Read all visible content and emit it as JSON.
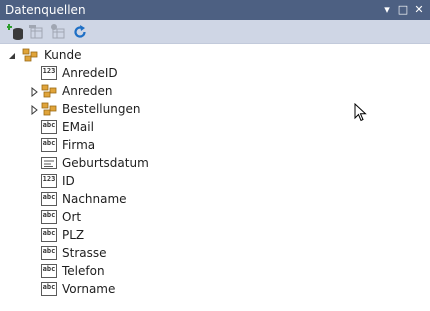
{
  "panel": {
    "title": "Datenquellen",
    "buttons": {
      "dropdown": "▾",
      "maximize": "□",
      "close": "✕"
    }
  },
  "toolbar": {
    "items": [
      {
        "name": "add-datasource-icon",
        "enabled": true
      },
      {
        "name": "edit-dataset-icon",
        "enabled": false
      },
      {
        "name": "configure-dataset-icon",
        "enabled": false
      },
      {
        "name": "refresh-icon",
        "enabled": true
      }
    ]
  },
  "tree": {
    "root": {
      "label": "Kunde",
      "icon": "object-icon",
      "expanded": true
    },
    "children": [
      {
        "label": "AnredeID",
        "icon": "numeric-field-icon",
        "icontext": "123"
      },
      {
        "label": "Anreden",
        "icon": "object-icon",
        "expandable": true
      },
      {
        "label": "Bestellungen",
        "icon": "object-icon",
        "expandable": true
      },
      {
        "label": "EMail",
        "icon": "text-field-icon",
        "icontext": "abc"
      },
      {
        "label": "Firma",
        "icon": "text-field-icon",
        "icontext": "abc"
      },
      {
        "label": "Geburtsdatum",
        "icon": "date-field-icon",
        "icontext": ""
      },
      {
        "label": "ID",
        "icon": "numeric-field-icon",
        "icontext": "123"
      },
      {
        "label": "Nachname",
        "icon": "text-field-icon",
        "icontext": "abc"
      },
      {
        "label": "Ort",
        "icon": "text-field-icon",
        "icontext": "abc"
      },
      {
        "label": "PLZ",
        "icon": "text-field-icon",
        "icontext": "abc"
      },
      {
        "label": "Strasse",
        "icon": "text-field-icon",
        "icontext": "abc"
      },
      {
        "label": "Telefon",
        "icon": "text-field-icon",
        "icontext": "abc"
      },
      {
        "label": "Vorname",
        "icon": "text-field-icon",
        "icontext": "abc"
      }
    ]
  },
  "colors": {
    "titlebar": "#4d6082",
    "toolbar": "#cfd6e5",
    "object_icon": "#e0a43a"
  }
}
